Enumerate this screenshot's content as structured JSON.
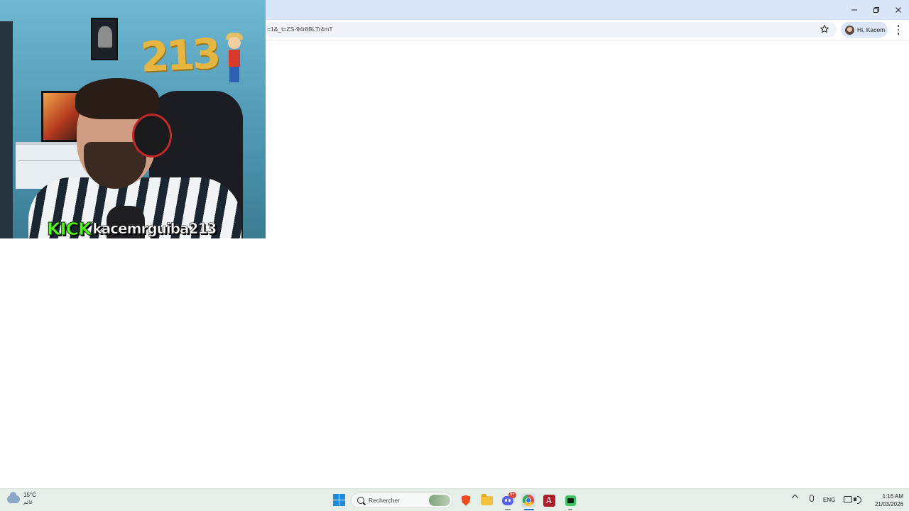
{
  "browser": {
    "url": "=1&_t=ZS-94r8BLTr4mT",
    "profile_label": "Hi, Kacem",
    "window_controls": [
      "minimize-icon",
      "restore-icon",
      "close-icon"
    ]
  },
  "stream_overlay": {
    "platform_logo": "KICK",
    "channel_name": "kacemrguiba213",
    "balloon_text": "213"
  },
  "taskbar": {
    "weather": {
      "temp": "15°C",
      "condition": "غائم"
    },
    "search_placeholder": "Rechercher",
    "apps": [
      "brave",
      "file-explorer",
      "discord",
      "chrome",
      "acrobat",
      "green-app"
    ],
    "discord_badge": "9+",
    "tray": {
      "language": "ENG"
    },
    "clock": {
      "time": "1:16 AM",
      "date": "21/03/2026"
    }
  },
  "colors": {
    "titlebar": "#d9e5f9",
    "kick_green": "#53fc18",
    "taskbar": "#e5efe8"
  }
}
